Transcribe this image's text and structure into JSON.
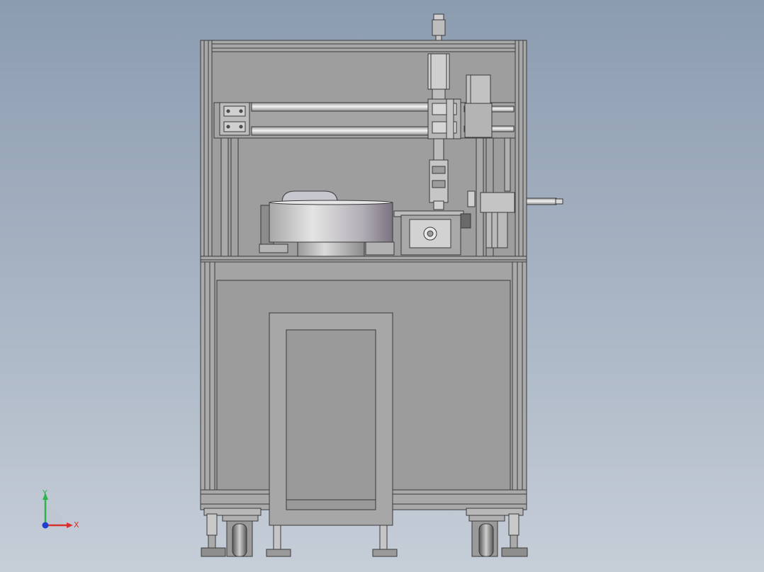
{
  "triad": {
    "y_label": "Y",
    "x_label": "X",
    "y_color": "#2db34a",
    "x_color": "#d93030",
    "z_color": "#2040d0"
  },
  "colors": {
    "frame": "#a6a6a6",
    "panel": "#9b9b9b",
    "outline": "#3a3a3a",
    "rod": "#e6e6e6",
    "bowl_light": "#dcdcdc",
    "bowl_dark": "#7d7782"
  }
}
